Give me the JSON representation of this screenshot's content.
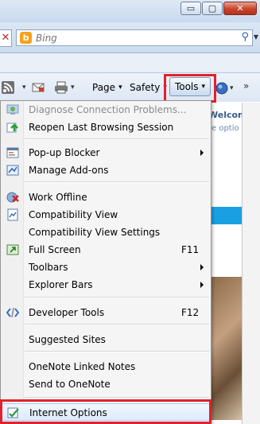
{
  "window": {
    "minimize_glyph": "▭",
    "maximize_glyph": "▢",
    "close_glyph": "✕"
  },
  "address_bar": {
    "stop_glyph": "✕",
    "search_placeholder": "Bing",
    "search_logo_letter": "b",
    "search_go_glyph": "⚲",
    "search_dropdown_glyph": "▼"
  },
  "command_bar": {
    "page_label": "Page",
    "safety_label": "Safety",
    "tools_label": "Tools",
    "dropdown_glyph": "▾",
    "overflow_glyph": "»"
  },
  "background_page": {
    "welcome_text": "Welcom",
    "options_text": "e optio"
  },
  "menu": {
    "items": [
      {
        "label": "Diagnose Connection Problems...",
        "shortcut": "",
        "submenu": false,
        "disabled": true,
        "icon": "diagnose-icon"
      },
      {
        "label": "Reopen Last Browsing Session",
        "shortcut": "",
        "submenu": false,
        "disabled": false,
        "icon": "reopen-session-icon"
      },
      {
        "label": "Pop-up Blocker",
        "shortcut": "",
        "submenu": true,
        "disabled": false,
        "icon": "popup-blocker-icon"
      },
      {
        "label": "Manage Add-ons",
        "shortcut": "",
        "submenu": false,
        "disabled": false,
        "icon": "addons-icon"
      },
      {
        "label": "Work Offline",
        "shortcut": "",
        "submenu": false,
        "disabled": false,
        "icon": "work-offline-icon"
      },
      {
        "label": "Compatibility View",
        "shortcut": "",
        "submenu": false,
        "disabled": false,
        "icon": "compatibility-view-icon"
      },
      {
        "label": "Compatibility View Settings",
        "shortcut": "",
        "submenu": false,
        "disabled": false,
        "icon": ""
      },
      {
        "label": "Full Screen",
        "shortcut": "F11",
        "submenu": false,
        "disabled": false,
        "icon": "full-screen-icon"
      },
      {
        "label": "Toolbars",
        "shortcut": "",
        "submenu": true,
        "disabled": false,
        "icon": ""
      },
      {
        "label": "Explorer Bars",
        "shortcut": "",
        "submenu": true,
        "disabled": false,
        "icon": ""
      },
      {
        "label": "Developer Tools",
        "shortcut": "F12",
        "submenu": false,
        "disabled": false,
        "icon": "developer-tools-icon"
      },
      {
        "label": "Suggested Sites",
        "shortcut": "",
        "submenu": false,
        "disabled": false,
        "icon": ""
      },
      {
        "label": "OneNote Linked Notes",
        "shortcut": "",
        "submenu": false,
        "disabled": false,
        "icon": ""
      },
      {
        "label": "Send to OneNote",
        "shortcut": "",
        "submenu": false,
        "disabled": false,
        "icon": ""
      },
      {
        "label": "Internet Options",
        "shortcut": "",
        "submenu": false,
        "disabled": false,
        "icon": "internet-options-icon"
      }
    ]
  },
  "colors": {
    "highlight_box": "#e0222d",
    "disabled_text": "#8b8b8b"
  }
}
